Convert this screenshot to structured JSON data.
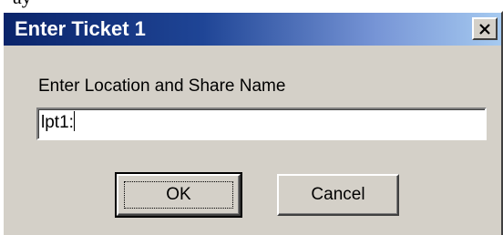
{
  "top_fragment": "ay",
  "dialog": {
    "title": "Enter Ticket 1",
    "close_icon": "close-x-icon",
    "prompt_label": "Enter Location and Share Name",
    "input_value": "lpt1:",
    "ok_label": "OK",
    "cancel_label": "Cancel"
  },
  "colors": {
    "titlebar_start": "#0a246a",
    "titlebar_end": "#a6caf0",
    "face": "#d4d0c8"
  }
}
